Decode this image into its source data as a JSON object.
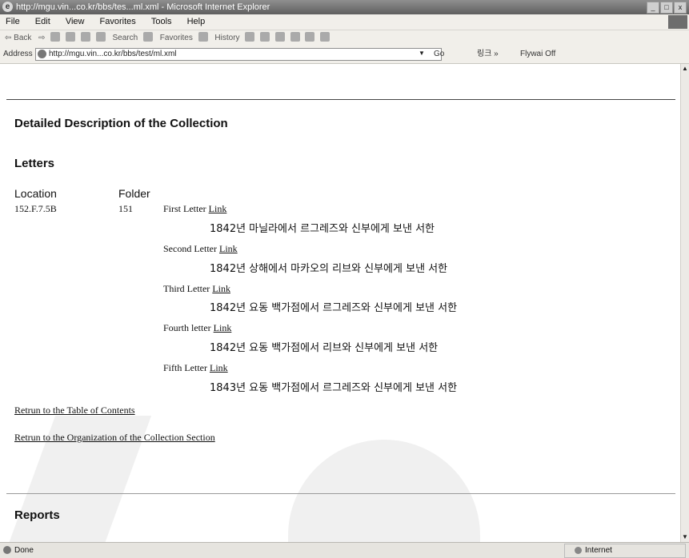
{
  "window": {
    "title": "http://mgu.vin...co.kr/bbs/tes...ml.xml - Microsoft Internet Explorer",
    "controls": [
      "_",
      "□",
      "x"
    ]
  },
  "menubar": [
    "File",
    "Edit",
    "View",
    "Favorites",
    "Tools",
    "Help"
  ],
  "toolbar": {
    "back": "⇦ Back",
    "forward": "⇨",
    "search": "Search",
    "favorites": "Favorites",
    "history": "History"
  },
  "addressbar": {
    "label": "Address",
    "url": "http://mgu.vin...co.kr/bbs/test/ml.xml",
    "go": "Go",
    "links": "링크 »",
    "flyby": "Flywai Off"
  },
  "page": {
    "section_title": "Detailed Description of the Collection",
    "subsection_title": "Letters",
    "col_location": "Location",
    "col_folder": "Folder",
    "location": "152.F.7.5B",
    "folder": "151",
    "letters": [
      {
        "label": "First Letter",
        "link": "Link",
        "desc": "1842년 마닐라에서 르그레즈와 신부에게 보낸 서한"
      },
      {
        "label": "Second Letter",
        "link": "Link",
        "desc": "1842년 상해에서 마카오의 리브와 신부에게 보낸 서한"
      },
      {
        "label": "Third Letter",
        "link": "Link",
        "desc": "1842년 요동 백가점에서 르그레즈와 신부에게 보낸 서한"
      },
      {
        "label": "Fourth letter",
        "link": "Link",
        "desc": "1842년 요동 백가점에서 리브와 신부에게 보낸 서한"
      },
      {
        "label": "Fifth Letter",
        "link": "Link",
        "desc": "1843년 요동 백가점에서 르그레즈와 신부에게 보낸 서한"
      }
    ],
    "return_toc": "Retrun to the Table of Contents",
    "return_org": "Retrun to the Organization of the Collection Section",
    "reports_title": "Reports"
  },
  "statusbar": {
    "status": "Done",
    "zone": "Internet"
  }
}
